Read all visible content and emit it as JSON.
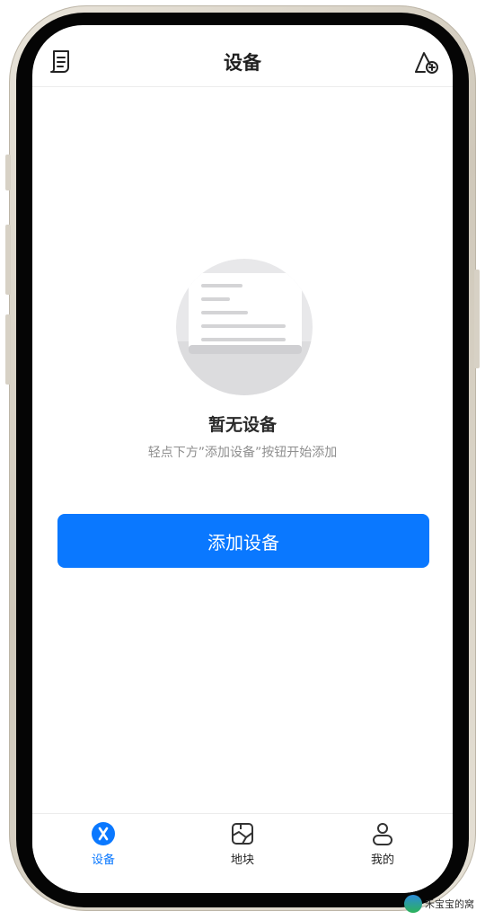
{
  "header": {
    "title": "设备",
    "left_icon": "document-list-icon",
    "right_icon": "add-location-icon"
  },
  "empty_state": {
    "illustration": "empty-document-icon",
    "title": "暂无设备",
    "subtitle": "轻点下方”添加设备”按钮开始添加"
  },
  "primary_action": {
    "label": "添加设备",
    "color": "#0a78ff"
  },
  "tabbar": {
    "tabs": [
      {
        "label": "设备",
        "icon": "device-icon",
        "active": true
      },
      {
        "label": "地块",
        "icon": "map-icon",
        "active": false
      },
      {
        "label": "我的",
        "icon": "user-icon",
        "active": false
      }
    ]
  },
  "watermark": {
    "text": "禾宝宝的窝"
  }
}
